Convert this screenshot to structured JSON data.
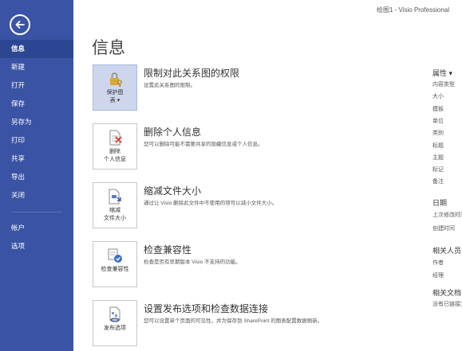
{
  "window": {
    "title": "绘图1 - Visio Professional"
  },
  "sidebar": {
    "items": [
      {
        "label": "信息",
        "active": true
      },
      {
        "label": "新建"
      },
      {
        "label": "打开"
      },
      {
        "label": "保存"
      },
      {
        "label": "另存为"
      },
      {
        "label": "打印"
      },
      {
        "label": "共享"
      },
      {
        "label": "导出"
      },
      {
        "label": "关闭"
      }
    ],
    "lower_items": [
      {
        "label": "帐户"
      },
      {
        "label": "选项"
      }
    ]
  },
  "main": {
    "title": "信息",
    "sections": [
      {
        "tile_label": "保护图\n表 ▾",
        "heading": "限制对此关系图的权限",
        "description": "设置此关系图的限制。",
        "icon": "lock-key-icon"
      },
      {
        "tile_label": "删除\n个人信息",
        "heading": "删除个人信息",
        "description": "您可以删除可能不需要共享的隐藏信息或个人信息。",
        "icon": "remove-info-icon"
      },
      {
        "tile_label": "缩减\n文件大小",
        "heading": "缩减文件大小",
        "description": "通过让 Visio 删除此文件中不使用的项可以减小文件大小。",
        "icon": "reduce-size-icon"
      },
      {
        "tile_label": "检查兼容性",
        "heading": "检查兼容性",
        "description": "检查是否有早期版本 Visio 不支持的功能。",
        "icon": "compatibility-icon"
      },
      {
        "tile_label": "发布选项",
        "heading": "设置发布选项和检查数据连接",
        "description": "您可以设置单个页面的可见性，并为保存到 SharePoint 的图表配置数据刷新。",
        "icon": "publish-icon"
      }
    ]
  },
  "properties": {
    "heading": "属性 ▾",
    "items": [
      "内容类型",
      "大小",
      "模板",
      "单位",
      "类别",
      "标题",
      "主题",
      "标记",
      "备注"
    ],
    "dates_heading": "日期",
    "dates_items": [
      "上次修改时间",
      "创建时间"
    ],
    "people_heading": "相关人员",
    "people_items": [
      "作者",
      "经理"
    ],
    "docs_heading": "相关文档",
    "docs_items": [
      "没有已链接文档"
    ]
  },
  "colors": {
    "sidebar": "#3a53a4",
    "sidebar_active": "#2c4692",
    "tile_selected": "#cdd6ec"
  }
}
